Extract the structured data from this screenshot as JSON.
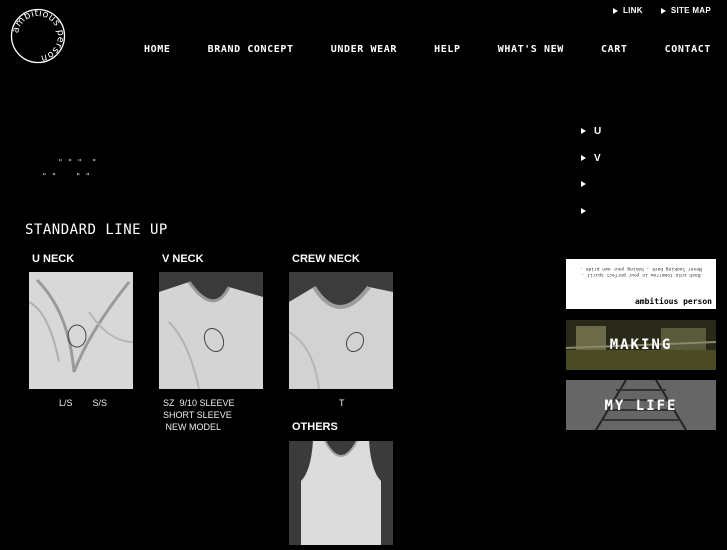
{
  "brand": {
    "logo_text": "ambitious person"
  },
  "top_links": [
    {
      "label": "LINK"
    },
    {
      "label": "SITE MAP"
    }
  ],
  "nav": [
    {
      "label": "HOME"
    },
    {
      "label": "BRAND CONCEPT"
    },
    {
      "label": "UNDER WEAR"
    },
    {
      "label": "HELP"
    },
    {
      "label": "WHAT'S NEW"
    },
    {
      "label": "CART"
    },
    {
      "label": "CONTACT"
    }
  ],
  "side_menu": [
    {
      "label": "U"
    },
    {
      "label": "V"
    },
    {
      "label": ""
    },
    {
      "label": ""
    }
  ],
  "intro": {
    "line1": "\" \" \"  \"",
    "line2": "\" \"    \" \""
  },
  "lineup": {
    "title": "STANDARD LINE UP",
    "products": [
      {
        "title": "U NECK",
        "caption": "L/S        S/S"
      },
      {
        "title": "V NECK",
        "caption": "SZ  9/10 SLEEVE\nSHORT SLEEVE\n NEW MODEL"
      },
      {
        "title": "CREW NECK",
        "caption": "T"
      }
    ],
    "others": {
      "title": "OTHERS"
    }
  },
  "banners": [
    {
      "text": "ambitious person",
      "line1": "Dash into tomorrow in your perfect spirit .",
      "line2": "Never looking back , having your own pride ."
    },
    {
      "text": "MAKING"
    },
    {
      "text": "MY LIFE"
    }
  ]
}
